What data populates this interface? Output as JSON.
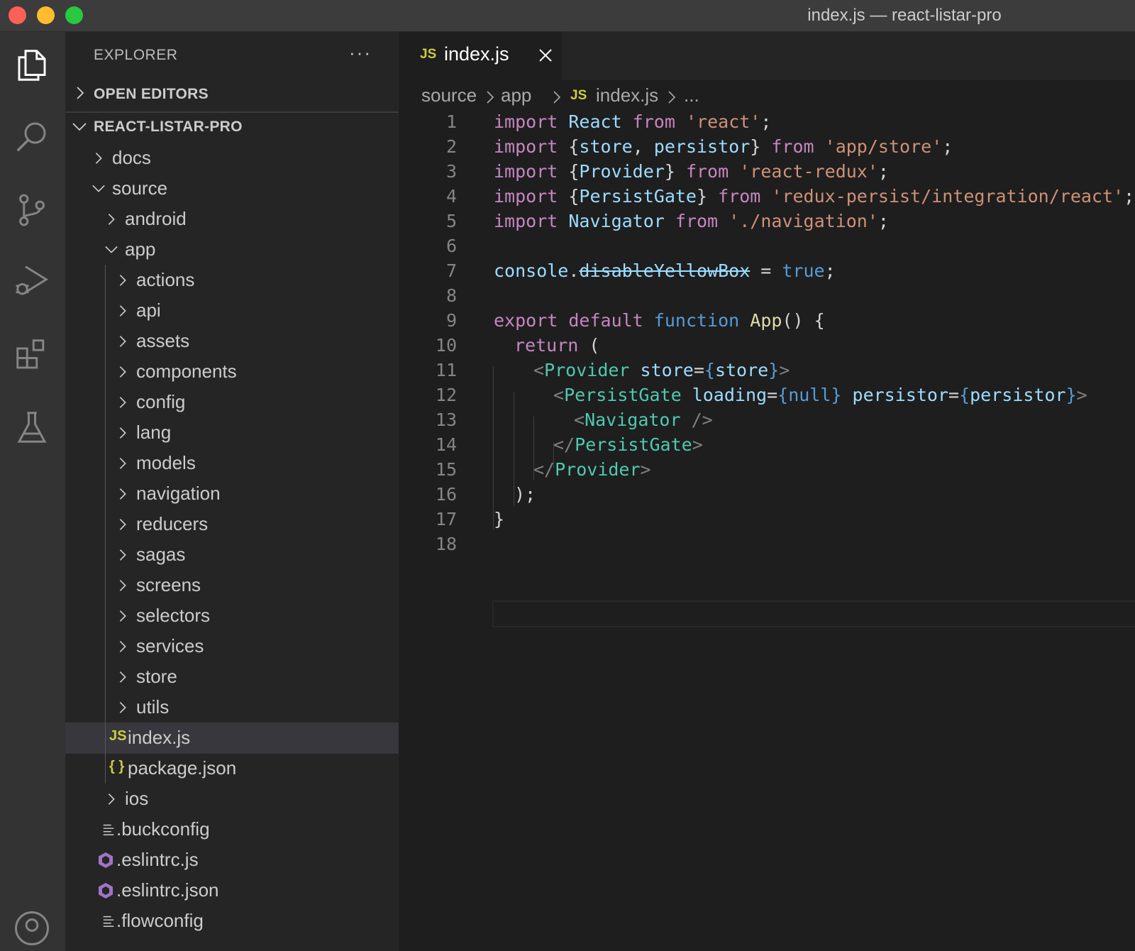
{
  "window": {
    "title": "index.js — react-listar-pro"
  },
  "explorer": {
    "title": "EXPLORER",
    "more": "···",
    "open_editors": "OPEN EDITORS",
    "project": "REACT-LISTAR-PRO"
  },
  "tree": [
    {
      "label": "docs",
      "kind": "folder",
      "expanded": false
    },
    {
      "label": "source",
      "kind": "folder",
      "expanded": true
    },
    {
      "label": "android",
      "kind": "folder",
      "expanded": false
    },
    {
      "label": "app",
      "kind": "folder",
      "expanded": true
    },
    {
      "label": "actions",
      "kind": "folder",
      "expanded": false
    },
    {
      "label": "api",
      "kind": "folder",
      "expanded": false
    },
    {
      "label": "assets",
      "kind": "folder",
      "expanded": false
    },
    {
      "label": "components",
      "kind": "folder",
      "expanded": false
    },
    {
      "label": "config",
      "kind": "folder",
      "expanded": false
    },
    {
      "label": "lang",
      "kind": "folder",
      "expanded": false
    },
    {
      "label": "models",
      "kind": "folder",
      "expanded": false
    },
    {
      "label": "navigation",
      "kind": "folder",
      "expanded": false
    },
    {
      "label": "reducers",
      "kind": "folder",
      "expanded": false
    },
    {
      "label": "sagas",
      "kind": "folder",
      "expanded": false
    },
    {
      "label": "screens",
      "kind": "folder",
      "expanded": false
    },
    {
      "label": "selectors",
      "kind": "folder",
      "expanded": false
    },
    {
      "label": "services",
      "kind": "folder",
      "expanded": false
    },
    {
      "label": "store",
      "kind": "folder",
      "expanded": false
    },
    {
      "label": "utils",
      "kind": "folder",
      "expanded": false
    },
    {
      "label": "index.js",
      "kind": "js-file",
      "icon_text": "JS",
      "selected": true
    },
    {
      "label": "package.json",
      "kind": "json-file",
      "icon_text": "{ }"
    },
    {
      "label": "ios",
      "kind": "folder",
      "expanded": false
    },
    {
      "label": ".buckconfig",
      "kind": "config-file"
    },
    {
      "label": ".eslintrc.js",
      "kind": "eslint-file"
    },
    {
      "label": ".eslintrc.json",
      "kind": "eslint-file"
    },
    {
      "label": ".flowconfig",
      "kind": "config-file"
    }
  ],
  "tab": {
    "icon_text": "JS",
    "label": "index.js"
  },
  "breadcrumb": {
    "parts": [
      "source",
      "app",
      "index.js",
      "..."
    ],
    "js_icon": "JS"
  },
  "code_lines": [
    {
      "n": "1"
    },
    {
      "n": "2"
    },
    {
      "n": "3"
    },
    {
      "n": "4"
    },
    {
      "n": "5"
    },
    {
      "n": "6"
    },
    {
      "n": "7"
    },
    {
      "n": "8"
    },
    {
      "n": "9"
    },
    {
      "n": "10"
    },
    {
      "n": "11"
    },
    {
      "n": "12"
    },
    {
      "n": "13"
    },
    {
      "n": "14"
    },
    {
      "n": "15"
    },
    {
      "n": "16"
    },
    {
      "n": "17"
    },
    {
      "n": "18"
    }
  ],
  "code_tokens": {
    "l1": [
      "import",
      " ",
      "React",
      " ",
      "from",
      " ",
      "'react'",
      ";"
    ],
    "l2": [
      "import",
      " {",
      "store",
      ", ",
      "persistor",
      "} ",
      "from",
      " ",
      "'app/store'",
      ";"
    ],
    "l3": [
      "import",
      " {",
      "Provider",
      "} ",
      "from",
      " ",
      "'react-redux'",
      ";"
    ],
    "l4": [
      "import",
      " {",
      "PersistGate",
      "} ",
      "from",
      " ",
      "'redux-persist/integration/react'",
      ";"
    ],
    "l5": [
      "import",
      " ",
      "Navigator",
      " ",
      "from",
      " ",
      "'./navigation'",
      ";"
    ],
    "l7": [
      "console",
      ".",
      "disableYellowBox",
      " = ",
      "true",
      ";"
    ],
    "l9": [
      "export",
      " ",
      "default",
      " ",
      "function",
      " ",
      "App",
      "() {"
    ],
    "l10": [
      "return",
      " ("
    ],
    "l11": [
      "<",
      "Provider",
      " ",
      "store",
      "=",
      "{",
      "store",
      "}",
      ">"
    ],
    "l12": [
      "<",
      "PersistGate",
      " ",
      "loading",
      "=",
      "{",
      "null",
      "}",
      " ",
      "persistor",
      "=",
      "{",
      "persistor",
      "}",
      ">"
    ],
    "l13": [
      "<",
      "Navigator",
      " />"
    ],
    "l14": [
      "</",
      "PersistGate",
      ">"
    ],
    "l15": [
      "</",
      "Provider",
      ">"
    ],
    "l16": [
      ");"
    ],
    "l17": [
      "}"
    ]
  },
  "colors": {
    "keyword": "#c586c0",
    "identifier": "#9cdcfe",
    "string": "#ce9178",
    "boolean": "#569cd6",
    "function": "#dcdcaa",
    "tag": "#4ec9b0",
    "js_icon": "#cbcb41",
    "eslint_icon": "#a074c4"
  },
  "activity_icons": [
    "files-icon",
    "search-icon",
    "source-control-icon",
    "run-debug-icon",
    "extensions-icon",
    "testing-icon",
    "account-icon"
  ]
}
